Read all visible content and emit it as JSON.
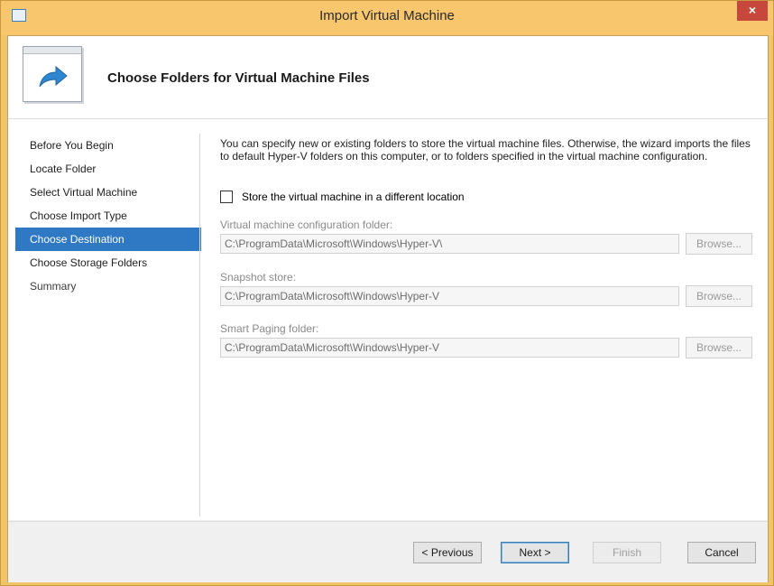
{
  "window": {
    "title": "Import Virtual Machine",
    "close_glyph": "×",
    "icon": "import-vm-icon",
    "accent": "#f8c66c"
  },
  "header": {
    "title": "Choose Folders for Virtual Machine Files",
    "icon": "import-arrow-icon"
  },
  "nav": {
    "items": [
      {
        "label": "Before You Begin"
      },
      {
        "label": "Locate Folder"
      },
      {
        "label": "Select Virtual Machine"
      },
      {
        "label": "Choose Import Type"
      },
      {
        "label": "Choose Destination",
        "selected": true
      },
      {
        "label": "Choose Storage Folders"
      },
      {
        "label": "Summary"
      }
    ],
    "selected_color": "#2f78c4"
  },
  "pane": {
    "description": "You can specify new or existing folders to store the virtual machine files. Otherwise, the wizard imports the files to default Hyper-V folders on this computer, or to folders specified in the virtual machine configuration.",
    "store_checkbox": {
      "label": "Store the virtual machine in a different location",
      "checked": false
    },
    "config_folder": {
      "label": "Virtual machine configuration folder:",
      "value": "C:\\ProgramData\\Microsoft\\Windows\\Hyper-V\\",
      "browse": "Browse..."
    },
    "snapshot_store": {
      "label": "Snapshot store:",
      "value": "C:\\ProgramData\\Microsoft\\Windows\\Hyper-V",
      "browse": "Browse..."
    },
    "smart_paging": {
      "label": "Smart Paging folder:",
      "value": "C:\\ProgramData\\Microsoft\\Windows\\Hyper-V",
      "browse": "Browse..."
    }
  },
  "footer": {
    "previous": "< Previous",
    "next": "Next >",
    "finish": "Finish",
    "cancel": "Cancel"
  }
}
